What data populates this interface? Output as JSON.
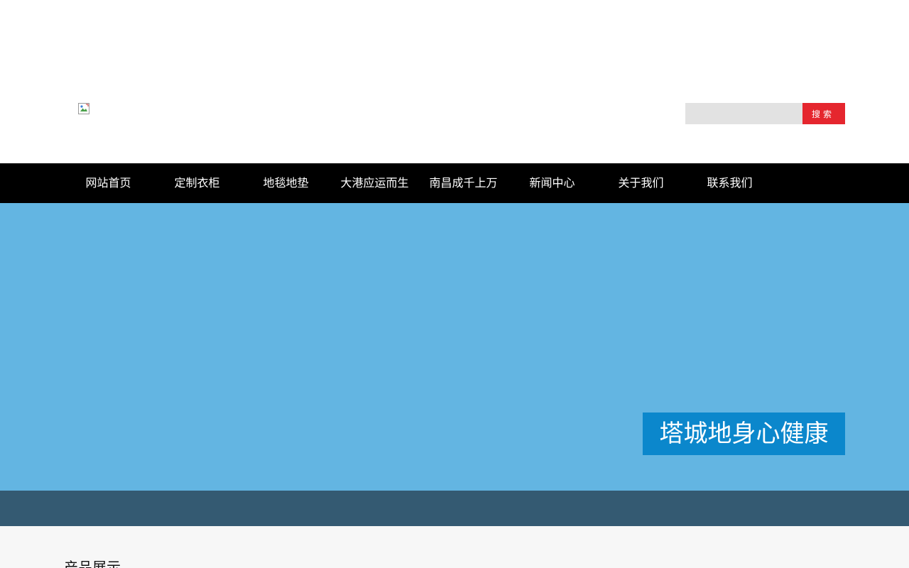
{
  "header": {
    "logo_icon": "broken-image-icon",
    "search": {
      "placeholder": "",
      "value": "",
      "button_label": "搜索"
    }
  },
  "nav": {
    "items": [
      {
        "label": "网站首页"
      },
      {
        "label": "定制衣柜"
      },
      {
        "label": "地毯地垫"
      },
      {
        "label": "大港应运而生"
      },
      {
        "label": "南昌成千上万"
      },
      {
        "label": "新闻中心"
      },
      {
        "label": "关于我们"
      },
      {
        "label": "联系我们"
      }
    ]
  },
  "banner": {
    "caption": "塔城地身心健康"
  },
  "section": {
    "title": "产品展示"
  },
  "colors": {
    "nav_background": "#000000",
    "search_button": "#e5262e",
    "search_input": "#e2e2e2",
    "banner_background": "#63b5e2",
    "caption_background": "#0b87cc",
    "band": "#345a72",
    "section_background": "#f7f7f7"
  }
}
